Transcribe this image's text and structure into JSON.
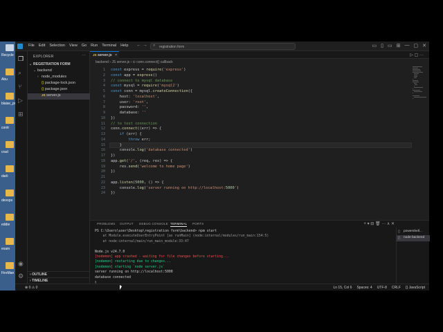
{
  "desktop": {
    "icons": [
      {
        "label": "Recycle",
        "kind": "bin"
      },
      {
        "label": "Abu",
        "kind": "folder"
      },
      {
        "label": "blaise_pr",
        "kind": "folder"
      },
      {
        "label": "contr",
        "kind": "folder"
      },
      {
        "label": "crad",
        "kind": "folder"
      },
      {
        "label": "darli",
        "kind": "folder"
      },
      {
        "label": "devops",
        "kind": "folder"
      },
      {
        "label": "eddie",
        "kind": "folder"
      },
      {
        "label": "exam",
        "kind": "folder"
      },
      {
        "label": "FireMan",
        "kind": "folder"
      }
    ]
  },
  "titlebar": {
    "menu": [
      "File",
      "Edit",
      "Selection",
      "View",
      "Go",
      "Run",
      "Terminal",
      "Help"
    ],
    "nav_arrows": "←  →",
    "search_text": "registration form",
    "window_controls": [
      "▭",
      "▯",
      "▭",
      "⊞",
      "—",
      "▢",
      "✕"
    ]
  },
  "sidebar": {
    "header": "EXPLORER",
    "more": "···",
    "project": "REGISTRATION FORM",
    "tree": [
      {
        "name": "backend",
        "kind": "folder-open"
      },
      {
        "name": "node_modules",
        "kind": "folder"
      },
      {
        "name": "package-lock.json",
        "kind": "json"
      },
      {
        "name": "package.json",
        "kind": "json"
      },
      {
        "name": "server.js",
        "kind": "js"
      }
    ],
    "outline": "OUTLINE",
    "timeline": "TIMELINE"
  },
  "editor": {
    "tab": {
      "label": "server.js",
      "close": "×",
      "icon": "JS"
    },
    "tab_actions": "▷ ▢ ···",
    "breadcrumb": "backend  ›  JS server.js  ›  ⊙ conn.connect() callback",
    "lines": [
      "const express = require('express')",
      "const app = express()",
      "// connect to mysql database",
      "const mysql = require('mysql2')",
      "const conn = mysql.createConnection({",
      "    host: 'localhost',",
      "    user: 'root',",
      "    password: '',",
      "    database: ''",
      "})",
      "// to test connection",
      "conn.connect((err) => {",
      "    if (err) {",
      "        throw err;",
      "    }",
      "    console.log('database connected')",
      "})",
      "app.get('/', (req, res) => {",
      "    res.send('welcome to home page')",
      "})",
      "",
      "app.listen(5000, () => {",
      "    console.log('server running on http://localhost:5000')",
      "})"
    ],
    "current_line": 15
  },
  "panel": {
    "tabs": [
      "PROBLEMS",
      "OUTPUT",
      "DEBUG CONSOLE",
      "TERMINAL",
      "PORTS"
    ],
    "active_tab": "TERMINAL",
    "actions": "+ ▾  ⊟  🗑  ···  ∧  ✕",
    "terminal": [
      {
        "text": "PS C:\\Users\\user\\Desktop\\registration form\\backend> npm start",
        "color": "#cccccc"
      },
      {
        "text": "    at Module.executeUserEntryPoint [as runMain] (node:internal/modules/run_main:154:5)",
        "color": "#9a9a9a"
      },
      {
        "text": "    at node:internal/main/run_main_module:33:47",
        "color": "#9a9a9a"
      },
      {
        "text": "",
        "color": "#cccccc"
      },
      {
        "text": "Node.js v24.7.0",
        "color": "#cccccc"
      },
      {
        "text": "[nodemon] app crashed - waiting for file changes before starting...",
        "color": "#f14c4c"
      },
      {
        "text": "[nodemon] restarting due to changes...",
        "color": "#23d18b"
      },
      {
        "text": "[nodemon] starting `node server.js`",
        "color": "#23d18b"
      },
      {
        "text": "server running on http://localhost:5000",
        "color": "#cccccc"
      },
      {
        "text": "database connected",
        "color": "#cccccc"
      },
      {
        "text": "▯",
        "color": "#cccccc"
      }
    ],
    "terminal_list": [
      {
        "label": "powershell...",
        "icon": ">_"
      },
      {
        "label": "node backend",
        "icon": ">_"
      }
    ]
  },
  "status": {
    "left": "⊗ 0  ⚠ 0",
    "position": "Ln 15, Col 6",
    "spaces": "Spaces: 4",
    "encoding": "UTF-8",
    "eol": "CRLF",
    "language": "{} JavaScript",
    "bell": "🔔"
  }
}
